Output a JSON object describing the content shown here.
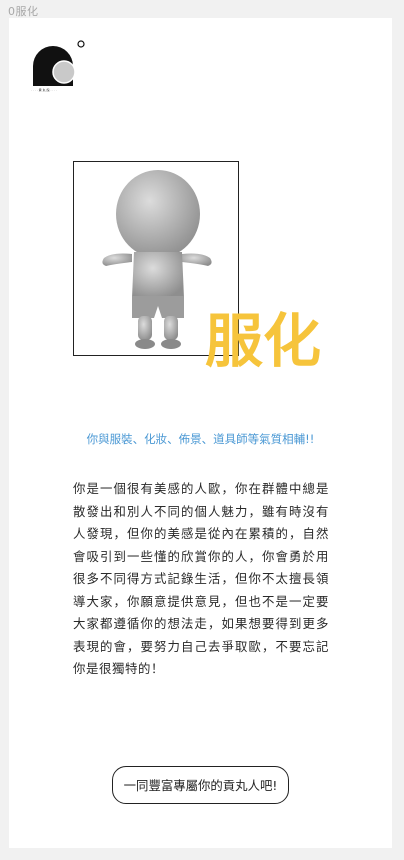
{
  "window": {
    "title": "0服化"
  },
  "logo": {
    "icon": "brand-logo-icon",
    "caption": "· · · · 貢 丸 館 · · · ·"
  },
  "hero": {
    "photo_icon": "character-figure-icon",
    "title": "服化"
  },
  "content": {
    "subtitle": "你與服裝、化妝、佈景、道具師等氣質相輔!!",
    "body": "你是一個很有美感的人歐，你在群體中總是散發出和別人不同的個人魅力，雖有時沒有人發現，但你的美感是從內在累積的，自然會吸引到一些懂的欣賞你的人，你會勇於用很多不同得方式記錄生活，但你不太擅長領導大家，你願意提供意見，但也不是一定要大家都遵循你的想法走，如果想要得到更多表現的會，要努力自己去爭取歐，不要忘記你是很獨特的！"
  },
  "cta": {
    "label": "一同豐富專屬你的貢丸人吧!"
  },
  "colors": {
    "accent": "#f6c43b",
    "subtitle": "#4a98d4"
  }
}
